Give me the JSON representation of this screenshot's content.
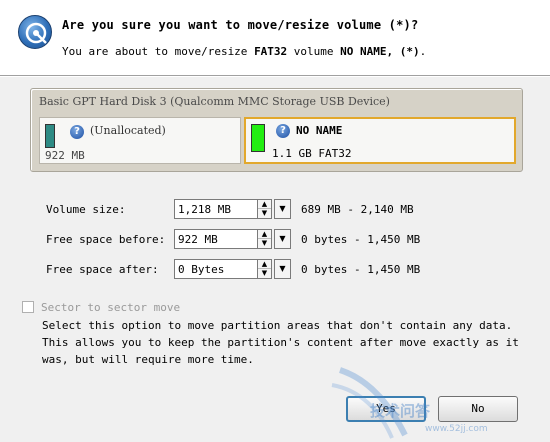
{
  "header": {
    "title": "Are you sure you want to move/resize volume (*)?",
    "subtitle_prefix": "You are about to move/resize ",
    "subtitle_fs": "FAT32",
    "subtitle_mid": " volume ",
    "subtitle_name": "NO NAME, (*)",
    "subtitle_suffix": ".",
    "icon": "disk-wizard-icon"
  },
  "disk": {
    "title": "Basic GPT Hard Disk 3 (Qualcomm MMC Storage USB Device)",
    "partitions": [
      {
        "name": "(Unallocated)",
        "size": "922 MB",
        "color": "#2e8b84",
        "icon": "help-icon"
      },
      {
        "name": "NO NAME",
        "size": "1.1 GB FAT32",
        "color": "#22ee11",
        "icon": "help-icon",
        "selected": true
      }
    ]
  },
  "fields": {
    "volume_size": {
      "label": "Volume size:",
      "value": "1,218 MB",
      "range": "689 MB - 2,140 MB"
    },
    "free_before": {
      "label": "Free space before:",
      "value": "922 MB",
      "range": "0 bytes - 1,450 MB"
    },
    "free_after": {
      "label": "Free space after:",
      "value": "0 Bytes",
      "range": "0 bytes - 1,450 MB"
    }
  },
  "sector_move": {
    "label": "Sector to sector move",
    "checked": false,
    "description": "Select this option to move partition areas that don't contain any data.\nThis allows you to keep the partition's content after move exactly as it\nwas, but will require more time."
  },
  "buttons": {
    "yes": "Yes",
    "no": "No"
  },
  "watermark": {
    "text": "技术问答",
    "url": "www.52jj.com"
  },
  "colors": {
    "accent": "#e2a82c",
    "default_button_border": "#3c7fb1"
  }
}
